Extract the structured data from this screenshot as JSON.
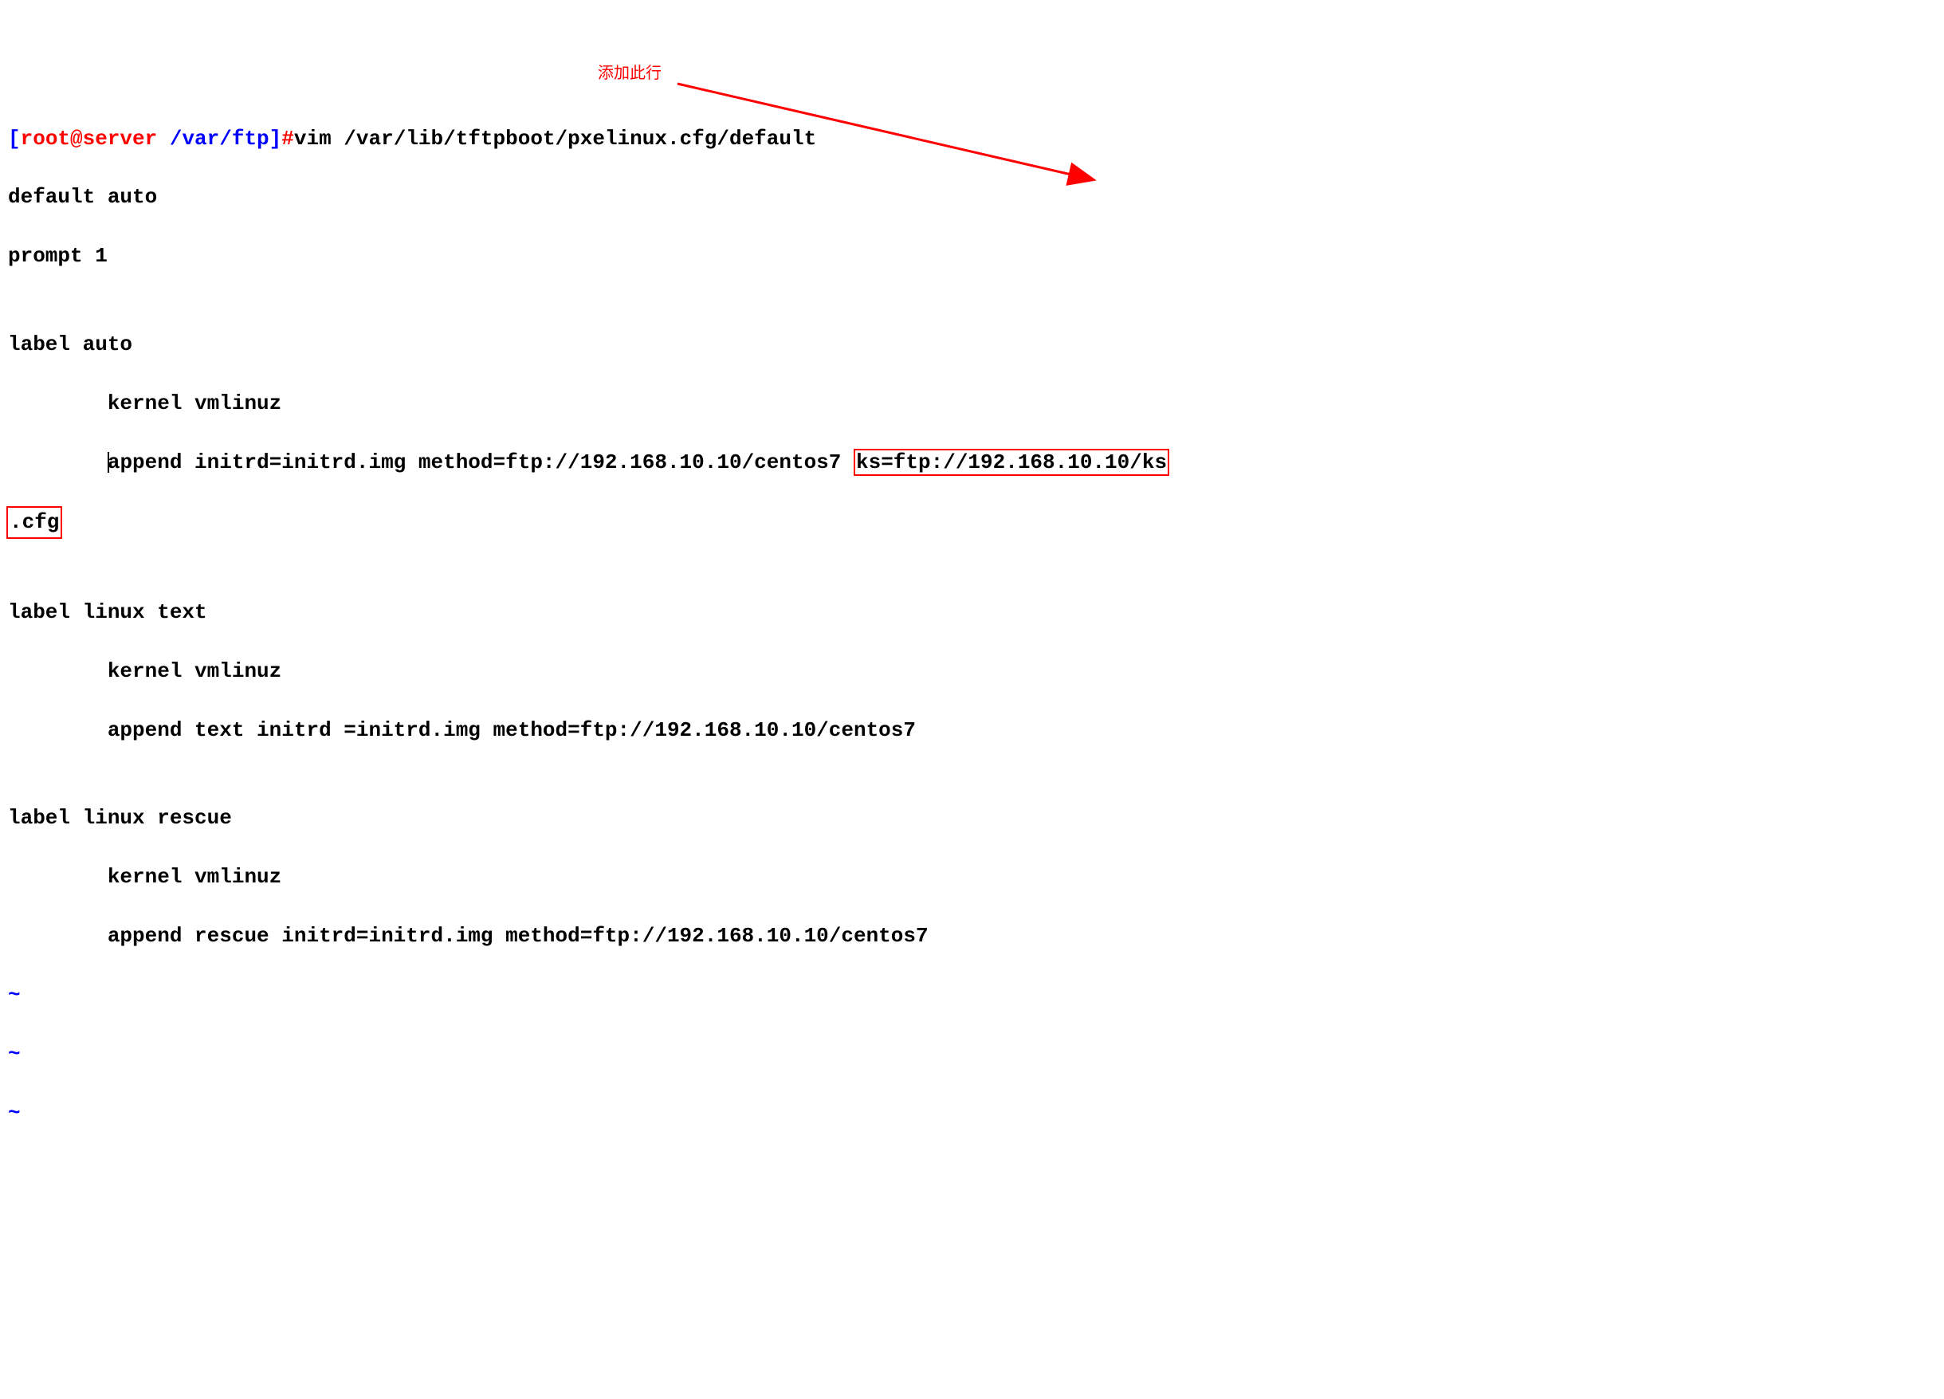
{
  "prompt": {
    "open_bracket": "[",
    "user_host": "root@server ",
    "path": "/var/ftp",
    "close_bracket": "]",
    "hash": "#"
  },
  "command": "vim /var/lib/tftpboot/pxelinux.cfg/default",
  "content": {
    "line1": "default auto",
    "line2": "prompt 1",
    "line3": "",
    "line4": "label auto",
    "line5_indent": "        ",
    "line5": "kernel vmlinuz",
    "line6_indent": "        ",
    "line6_pre_cursor": "",
    "line6_cursor": "a",
    "line6_after": "ppend initrd=initrd.img method=ftp://192.168.10.10/centos7 ",
    "line6_highlight": "ks=ftp://192.168.10.10/ks",
    "line7_highlight": ".cfg",
    "line8": "",
    "line9": "label linux text",
    "line10_indent": "        ",
    "line10": "kernel vmlinuz",
    "line11_indent": "        ",
    "line11": "append text initrd =initrd.img method=ftp://192.168.10.10/centos7",
    "line12": "",
    "line13": "label linux rescue",
    "line14_indent": "        ",
    "line14": "kernel vmlinuz",
    "line15_indent": "        ",
    "line15": "append rescue initrd=initrd.img method=ftp://192.168.10.10/centos7"
  },
  "tildes": [
    "~",
    "~",
    "~"
  ],
  "annotation": {
    "text": "添加此行"
  }
}
